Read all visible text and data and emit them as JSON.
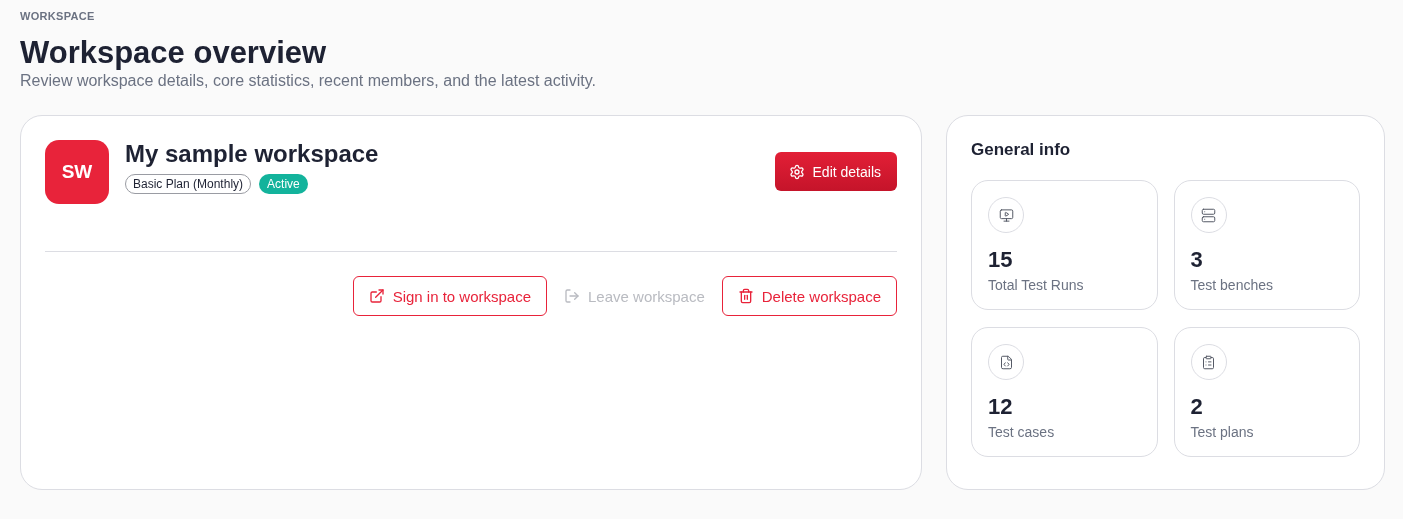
{
  "eyebrow": "WORKSPACE",
  "title": "Workspace overview",
  "subtitle": "Review workspace details, core statistics, recent members, and the latest activity.",
  "workspace": {
    "initials": "SW",
    "name": "My sample workspace",
    "plan": "Basic Plan (Monthly)",
    "status": "Active",
    "edit_button": "Edit details",
    "actions": [
      {
        "kind": "signin",
        "label": "Sign in to workspace",
        "disabled": false
      },
      {
        "kind": "leave",
        "label": "Leave workspace",
        "disabled": true
      },
      {
        "kind": "delete",
        "label": "Delete workspace",
        "disabled": false
      }
    ]
  },
  "general_info": {
    "title": "General info",
    "stats": [
      {
        "kind": "runs",
        "value": "15",
        "label": "Total Test Runs"
      },
      {
        "kind": "benches",
        "value": "3",
        "label": "Test benches"
      },
      {
        "kind": "cases",
        "value": "12",
        "label": "Test cases"
      },
      {
        "kind": "plans",
        "value": "2",
        "label": "Test plans"
      }
    ]
  }
}
